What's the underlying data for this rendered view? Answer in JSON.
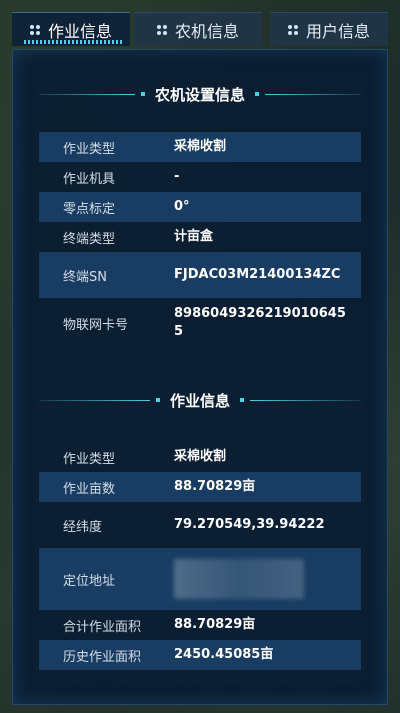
{
  "tabs": [
    {
      "label": "作业信息",
      "active": true
    },
    {
      "label": "农机信息",
      "active": false
    },
    {
      "label": "用户信息",
      "active": false
    }
  ],
  "machine_section": {
    "title": "农机设置信息",
    "rows": [
      {
        "key": "作业类型",
        "value": "采棉收割"
      },
      {
        "key": "作业机具",
        "value": "-"
      },
      {
        "key": "零点标定",
        "value": "0°"
      },
      {
        "key": "终端类型",
        "value": "计亩盒"
      },
      {
        "key": "终端SN",
        "value": "FJDAC03M21400134ZC"
      },
      {
        "key": "物联网卡号",
        "value": "89860493262190106455"
      }
    ]
  },
  "work_section": {
    "title": "作业信息",
    "rows": [
      {
        "key": "作业类型",
        "value": "采棉收割"
      },
      {
        "key": "作业亩数",
        "value": "88.70829亩"
      },
      {
        "key": "经纬度",
        "value": "79.270549,39.94222"
      },
      {
        "key": "定位地址",
        "value": ""
      },
      {
        "key": "合计作业面积",
        "value": "88.70829亩"
      },
      {
        "key": "历史作业面积",
        "value": "2450.45085亩"
      }
    ]
  },
  "colors": {
    "accent": "#4cd0e6",
    "panel_bg": "#0a1c32",
    "row_highlight": "#193d62"
  }
}
